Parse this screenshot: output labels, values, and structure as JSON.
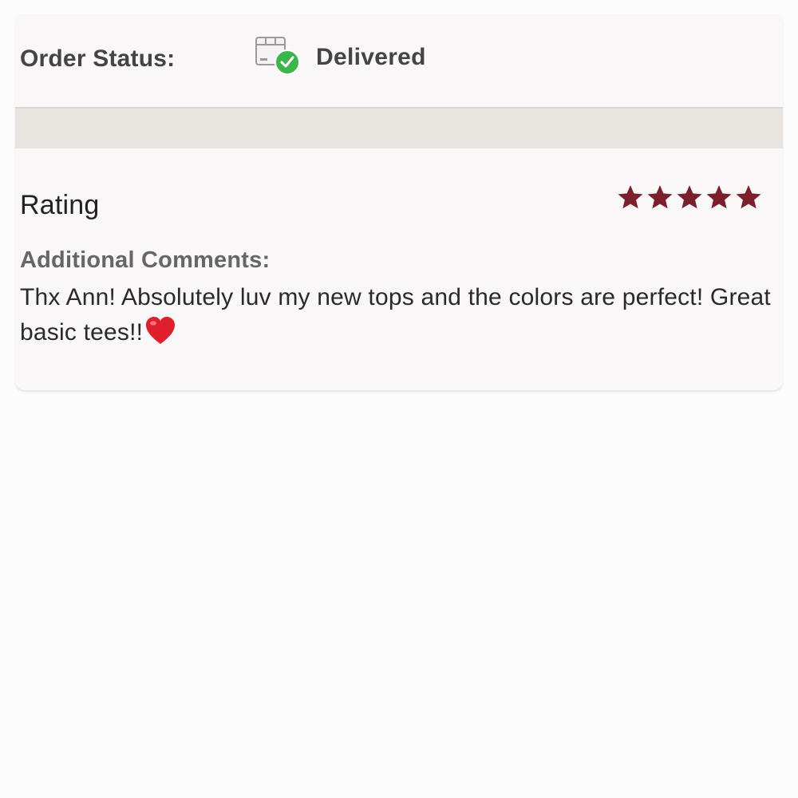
{
  "order": {
    "status_label": "Order Status:",
    "status_value": "Delivered",
    "status_icon": "package-delivered-icon"
  },
  "review": {
    "rating_label": "Rating",
    "rating_value": 5,
    "rating_max": 5,
    "star_color": "#7a1f2b",
    "comments_label": "Additional Comments:",
    "comments_text": "Thx Ann! Absolutely luv my new tops and the colors are perfect! Great basic tees!!",
    "comments_emoji": "heart-emoji"
  },
  "colors": {
    "check_green": "#3cb54a",
    "heart_red": "#e01f2d"
  }
}
